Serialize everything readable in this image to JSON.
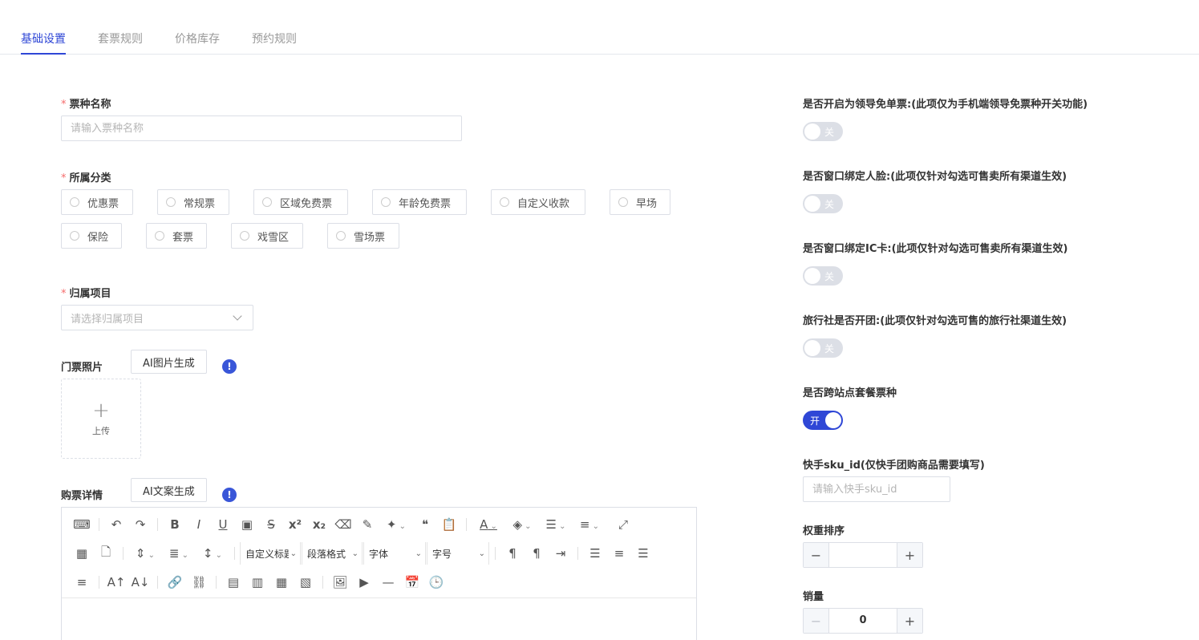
{
  "tabs": [
    "基础设置",
    "套票规则",
    "价格库存",
    "预约规则"
  ],
  "ticket_name": {
    "label": "票种名称",
    "required_mark": "*",
    "placeholder": "请输入票种名称"
  },
  "category": {
    "label": "所属分类",
    "required_mark": "*",
    "options": [
      "优惠票",
      "常规票",
      "区域免费票",
      "年龄免费票",
      "自定义收款",
      "早场",
      "保险",
      "套票",
      "戏雪区",
      "雪场票"
    ]
  },
  "project": {
    "label": "归属项目",
    "required_mark": "*",
    "placeholder": "请选择归属项目"
  },
  "photo": {
    "label": "门票照片",
    "ai_button": "AI图片生成",
    "info": "!",
    "upload_plus": "+",
    "upload_text": "上传"
  },
  "details": {
    "label": "购票详情",
    "ai_button": "AI文案生成",
    "info": "!"
  },
  "editor_toolbar": {
    "custom_title": "自定义标题",
    "paragraph_format": "段落格式",
    "font_family": "字体",
    "font_size": "字号"
  },
  "switches": [
    {
      "label": "是否开启为领导免单票:(此项仅为手机端领导免票种开关功能)",
      "state": "off",
      "text": "关"
    },
    {
      "label": "是否窗口绑定人脸:(此项仅针对勾选可售卖所有渠道生效)",
      "state": "off",
      "text": "关"
    },
    {
      "label": "是否窗口绑定IC卡:(此项仅针对勾选可售卖所有渠道生效)",
      "state": "off",
      "text": "关"
    },
    {
      "label": "旅行社是否开团:(此项仅针对勾选可售的旅行社渠道生效)",
      "state": "off",
      "text": "关"
    },
    {
      "label": "是否跨站点套餐票种",
      "state": "on",
      "text": "开"
    }
  ],
  "kuaishou": {
    "label": "快手sku_id(仅快手团购商品需要填写)",
    "placeholder": "请输入快手sku_id"
  },
  "weight": {
    "label": "权重排序",
    "value": "",
    "minus": "−",
    "plus": "+"
  },
  "sales": {
    "label": "销量",
    "value": "0",
    "minus": "−",
    "plus": "+"
  },
  "colors": {
    "primary": "#2f47d6",
    "required": "#f56c6c",
    "info": "#3956d8"
  }
}
